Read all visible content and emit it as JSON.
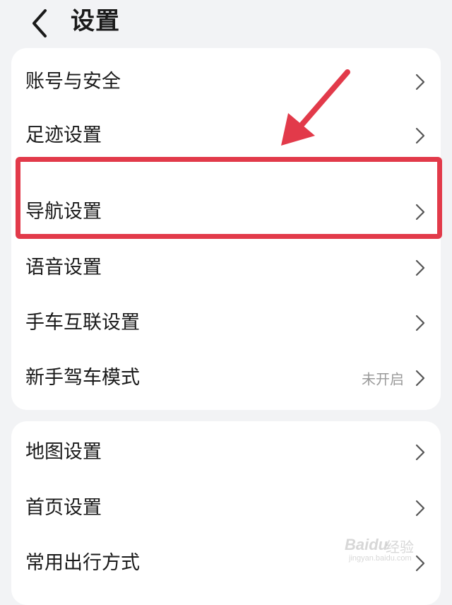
{
  "header": {
    "title": "设置",
    "back_icon": "chevron-left-icon"
  },
  "group_1": {
    "items": [
      {
        "label": "账号与安全",
        "status": ""
      },
      {
        "label": "足迹设置",
        "status": ""
      },
      {
        "label": "导航设置",
        "status": ""
      },
      {
        "label": "语音设置",
        "status": ""
      },
      {
        "label": "手车互联设置",
        "status": ""
      },
      {
        "label": "新手驾车模式",
        "status": "未开启"
      }
    ]
  },
  "group_2": {
    "items": [
      {
        "label": "地图设置",
        "status": ""
      },
      {
        "label": "首页设置",
        "status": ""
      },
      {
        "label": "常用出行方式",
        "status": ""
      }
    ]
  },
  "annotation": {
    "highlight_color": "#e23a4a",
    "arrow_color": "#e23a4a"
  },
  "watermark": {
    "brand": "Baidu",
    "sub": "经验",
    "url": "jingyan.baidu.com"
  },
  "colors": {
    "background": "#f2f3f5",
    "card": "#ffffff",
    "text": "#1a1a1a",
    "secondary_text": "#9a9a9a"
  }
}
